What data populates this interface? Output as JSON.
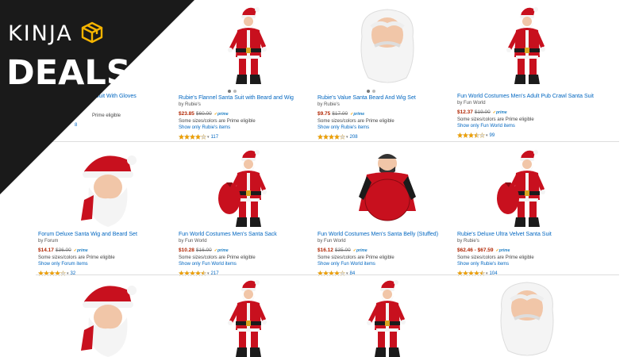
{
  "brand": {
    "kinja": "KINJA",
    "deals": "DEALS"
  },
  "colors": {
    "link": "#0066c0",
    "price": "#b12704",
    "banner": "#1a1a1a",
    "star": "#f0a000"
  },
  "products": [
    {
      "title": "Suit With Gloves",
      "brand": "",
      "price": "",
      "list_price": "",
      "prime": false,
      "eligible": "Prime eligible",
      "show_only": "",
      "rating": 4,
      "count": "8",
      "image": "santa-full-suit"
    },
    {
      "title": "Rubie's Flannel Santa Suit with Beard and Wig",
      "brand": "by Rubie's",
      "price": "$23.85",
      "list_price": "$60.00",
      "prime": true,
      "eligible": "Some sizes/colors are Prime eligible",
      "show_only": "Show only Rubie's items",
      "rating": 4,
      "count": "117",
      "image": "santa-full-suit"
    },
    {
      "title": "Rubie's Value Santa Beard And Wig Set",
      "brand": "by Rubie's",
      "price": "$9.75",
      "list_price": "$17.00",
      "prime": true,
      "eligible": "Some sizes/colors are Prime eligible",
      "show_only": "Show only Rubie's items",
      "rating": 4,
      "count": "208",
      "image": "santa-beard-wig"
    },
    {
      "title": "Fun World Costumes Men's Adult Pub Crawl Santa Suit",
      "brand": "by Fun World",
      "price": "$12.37",
      "list_price": "$19.00",
      "prime": true,
      "eligible": "Some sizes/colors are Prime eligible",
      "show_only": "Show only Fun World items",
      "rating": 3.5,
      "count": "99",
      "image": "santa-full-suit"
    },
    {
      "title": "Forum Deluxe Santa Wig and Beard Set",
      "brand": "by Forum",
      "price": "$14.17",
      "list_price": "$36.00",
      "prime": true,
      "eligible": "Some sizes/colors are Prime eligible",
      "show_only": "Show only Forum items",
      "rating": 4,
      "count": "32",
      "image": "santa-hat-beard"
    },
    {
      "title": "Fun World Costumes Men's Santa Sack",
      "brand": "by Fun World",
      "price": "$10.28",
      "list_price": "$16.00",
      "prime": true,
      "eligible": "Some sizes/colors are Prime eligible",
      "show_only": "Show only Fun World items",
      "rating": 4.5,
      "count": "217",
      "image": "santa-sack"
    },
    {
      "title": "Fun World Costumes Men's Santa Belly (Stuffed)",
      "brand": "by Fun World",
      "price": "$16.12",
      "list_price": "$35.00",
      "prime": true,
      "eligible": "Some sizes/colors are Prime eligible",
      "show_only": "Show only Fun World items",
      "rating": 4,
      "count": "84",
      "image": "santa-belly"
    },
    {
      "title": "Rubie's Deluxe Ultra Velvet Santa Suit",
      "brand": "by Rubie's",
      "price": "$62.46 - $67.59",
      "list_price": "",
      "prime": true,
      "eligible": "Some sizes/colors are Prime eligible",
      "show_only": "Show only Rubie's items",
      "rating": 4.5,
      "count": "104",
      "image": "santa-sack"
    },
    {
      "title": "",
      "image": "santa-hat-beard"
    },
    {
      "title": "",
      "image": "santa-full-suit"
    },
    {
      "title": "",
      "image": "santa-full-suit"
    },
    {
      "title": "",
      "image": "santa-beard-wig"
    }
  ]
}
